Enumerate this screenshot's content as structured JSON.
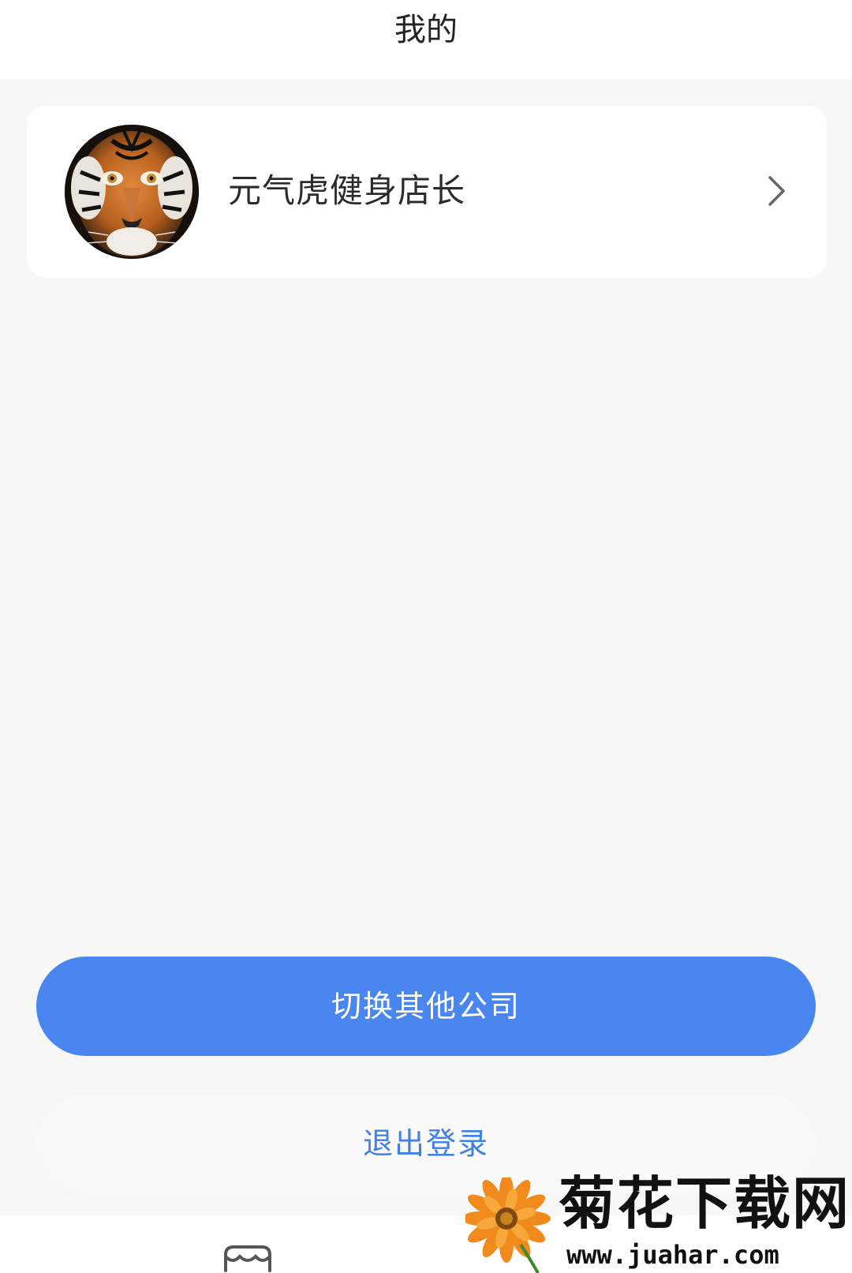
{
  "header": {
    "title": "我的"
  },
  "profile": {
    "name": "元气虎健身店长",
    "avatar_icon": "tiger-avatar"
  },
  "actions": {
    "switch_company_label": "切换其他公司",
    "logout_label": "退出登录"
  },
  "bottom_nav": {
    "items": [
      {
        "icon": "store-icon"
      }
    ]
  },
  "watermark": {
    "title": "菊花下载网",
    "url": "www.juahar.com"
  },
  "colors": {
    "background": "#f7f7f7",
    "primary_button": "#4a86f0",
    "logout_text": "#3f7fe6"
  }
}
